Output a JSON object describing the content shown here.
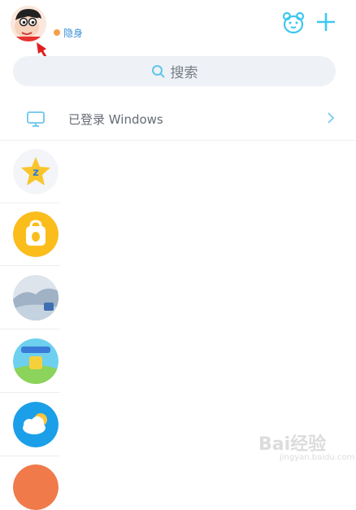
{
  "header": {
    "status_text": "隐身",
    "avatar_icon": "cartoon-avatar-icon",
    "bear_icon": "bear-face-icon",
    "plus_icon": "plus-icon",
    "accent_color": "#3ec8f0"
  },
  "search": {
    "label": "搜索",
    "icon": "search-icon"
  },
  "login_status": {
    "text": "已登录 Windows",
    "icon": "monitor-icon"
  },
  "apps": [
    {
      "icon": "qzone-star-icon"
    },
    {
      "icon": "qq-shop-bag-icon"
    },
    {
      "icon": "landscape-app-icon"
    },
    {
      "icon": "game-app-icon"
    },
    {
      "icon": "weather-cloud-icon"
    },
    {
      "icon": "app-icon"
    }
  ],
  "watermark": {
    "text": "Bai经验",
    "sub": "jingyan.baidu.com"
  }
}
